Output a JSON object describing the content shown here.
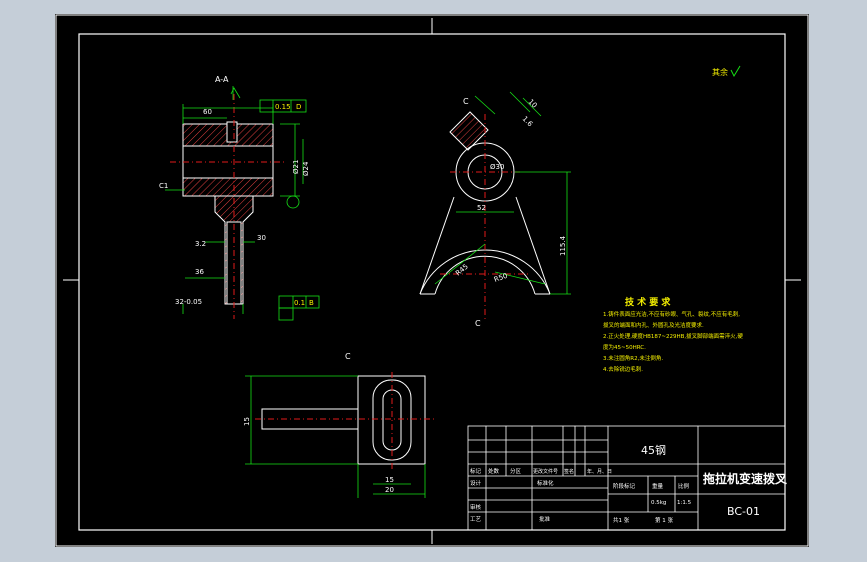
{
  "drawing": {
    "roughness_label": "其余",
    "section_label": "A-A",
    "view_c_label": "C",
    "view_c2_label": "C",
    "tech": {
      "title": "技 术 要 求",
      "items": [
        "1.铸件表面应光洁,不应有砂眼、气孔、裂纹,不应有毛刺,",
        "  拔叉的端面和内孔、外圆孔及光洁度要求.",
        "2.正火处理,硬度HB187~229HB,拔叉脚部端面需淬火,硬",
        "  度为45~50HRC.",
        "3.未注圆角R2,未注倒角.",
        "4.去除锐边毛刺."
      ]
    },
    "dims": {
      "d1": "60",
      "d2": "0.15",
      "d3": "D",
      "d4": "C1",
      "d5": "36",
      "d6": "Ø21",
      "d7": "Ø24",
      "d8": "30",
      "d9": "3.2",
      "d10": "0.1",
      "d11": "B",
      "d12": "32-0.05",
      "d13": "52",
      "d14": "Ø30",
      "d15": "115.4",
      "d16": "R45",
      "d17": "R50",
      "d18": "10",
      "d19": "15",
      "d20": "20",
      "d21": "22",
      "d22": "1.6",
      "d23": "6.3"
    },
    "title_block": {
      "material": "45钢",
      "part_name": "拖拉机变速拨叉",
      "drawing_no": "BC-01",
      "weight": "0.5kg",
      "scale": "1:1.5",
      "sheet": "共1 张",
      "sheet_no": "第 1 张",
      "labels": {
        "mark": "标记",
        "count": "处数",
        "zone": "分区",
        "change_doc": "更改文件号",
        "sign": "签名",
        "date": "年、月、日",
        "design": "设计",
        "standard": "标准化",
        "stage": "阶段标记",
        "weight_label": "重量",
        "scale_label": "比例",
        "review": "审核",
        "process": "工艺",
        "approve": "批准"
      }
    }
  }
}
